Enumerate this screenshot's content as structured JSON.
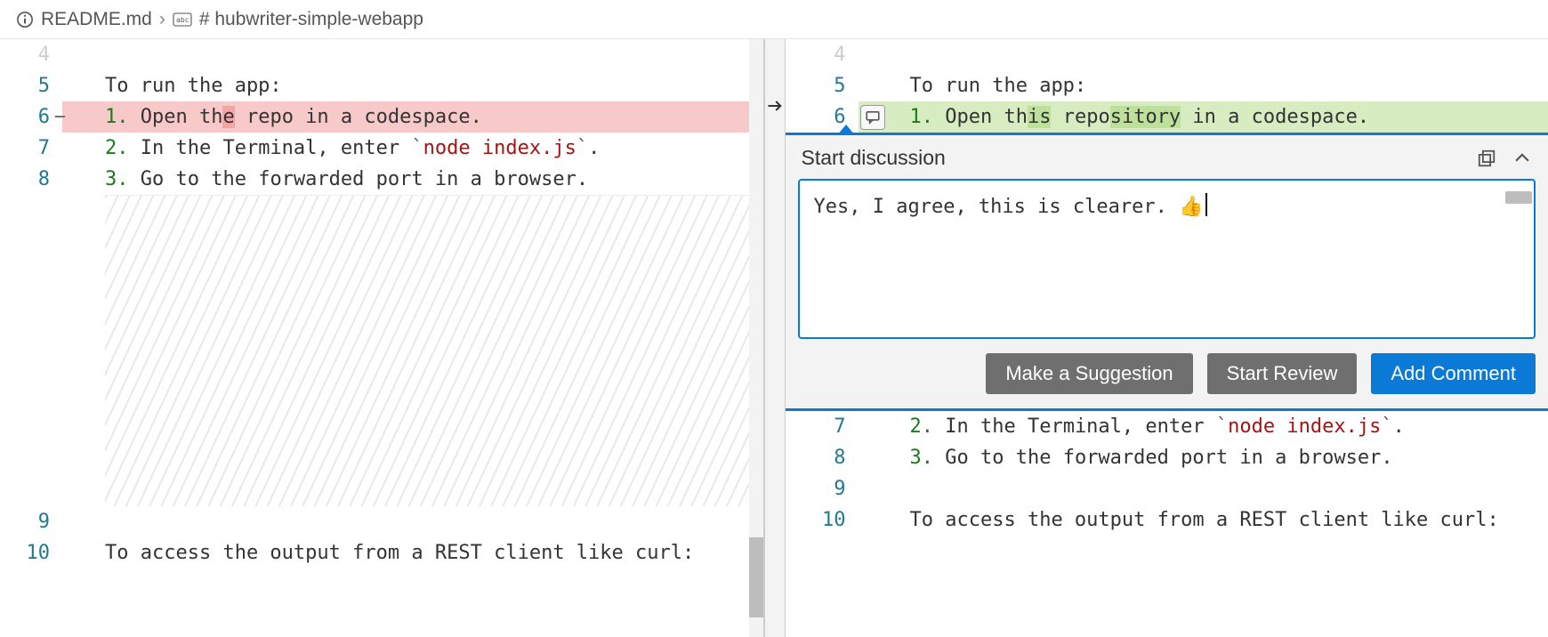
{
  "breadcrumb": {
    "file": "README.md",
    "section": "# hubwriter-simple-webapp"
  },
  "left": {
    "lines": [
      {
        "n": 4,
        "text": ""
      },
      {
        "n": 5,
        "text": "To run the app:"
      },
      {
        "n": 6,
        "text_pre": "1. Open th",
        "text_del": "e",
        "text_mid": " repo",
        "text_post": " in a codespace.",
        "removed": true
      },
      {
        "n": 7,
        "num": "2.",
        "plain": " In the Terminal, enter ",
        "code": "node index.js",
        "tail": "."
      },
      {
        "n": 8,
        "num": "3.",
        "plain": " Go to the forwarded port in a browser."
      },
      {
        "n": 9,
        "text": ""
      },
      {
        "n": 10,
        "text": "To access the output from a REST client like curl:"
      }
    ]
  },
  "right": {
    "lines_top": [
      {
        "n": 4,
        "text": ""
      },
      {
        "n": 5,
        "text": "To run the app:"
      },
      {
        "n": 6,
        "text_pre": "1. Open th",
        "text_add1": "is",
        "text_mid": " repo",
        "text_add2": "sitory",
        "text_post": " in a codespace.",
        "added": true
      }
    ],
    "lines_bottom": [
      {
        "n": 7,
        "num": "2.",
        "plain": " In the Terminal, enter ",
        "code": "node index.js",
        "tail": "."
      },
      {
        "n": 8,
        "num": "3.",
        "plain": " Go to the forwarded port in a browser."
      },
      {
        "n": 9,
        "text": ""
      },
      {
        "n": 10,
        "text": "To access the output from a REST client like curl:"
      }
    ]
  },
  "discussion": {
    "title": "Start discussion",
    "comment": "Yes, I agree, this is clearer. 👍",
    "buttons": {
      "suggestion": "Make a Suggestion",
      "review": "Start Review",
      "add": "Add Comment"
    }
  }
}
